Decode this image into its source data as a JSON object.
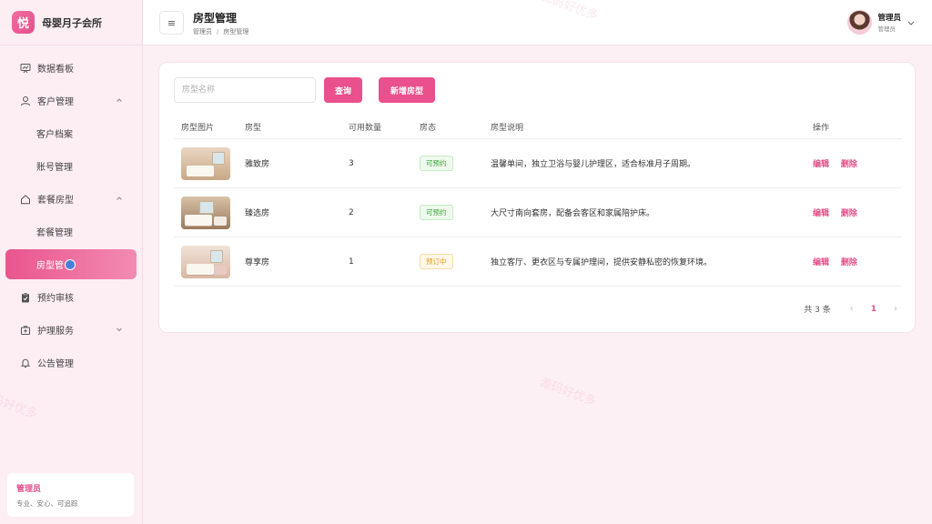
{
  "brand": {
    "logo_char": "悦",
    "name": "母婴月子会所"
  },
  "sidebar": {
    "items": [
      {
        "label": "数据看板",
        "icon": "chart-board-icon"
      },
      {
        "label": "客户管理",
        "icon": "user-icon",
        "expanded": true
      },
      {
        "label": "客户档案",
        "sub": true
      },
      {
        "label": "账号管理",
        "sub": true
      },
      {
        "label": "套餐房型",
        "icon": "home-icon",
        "expanded": true
      },
      {
        "label": "套餐管理",
        "sub": true
      },
      {
        "label": "房型管",
        "sub": true,
        "active": true
      },
      {
        "label": "预约审核",
        "icon": "clipboard-check-icon"
      },
      {
        "label": "护理服务",
        "icon": "first-aid-icon",
        "expanded": false
      },
      {
        "label": "公告管理",
        "icon": "bell-icon"
      }
    ],
    "card": {
      "title": "管理员",
      "subtitle": "专业、安心、可追踪"
    }
  },
  "header": {
    "menu_icon": "≡",
    "title": "房型管理",
    "breadcrumb": [
      "管理员",
      "房型管理"
    ],
    "breadcrumb_sep": "/",
    "user": {
      "name": "管理员",
      "role": "管理员"
    }
  },
  "search": {
    "placeholder": "房型名称",
    "value": "",
    "query_label": "查询",
    "add_label": "新增房型"
  },
  "table": {
    "columns": [
      "房型图片",
      "房型",
      "可用数量",
      "房态",
      "房型说明",
      "操作"
    ],
    "rows": [
      {
        "name": "雅致房",
        "qty": "3",
        "status": "可预约",
        "status_type": "ok",
        "desc": "温馨单间，独立卫浴与婴儿护理区，适合标准月子周期。"
      },
      {
        "name": "臻选房",
        "qty": "2",
        "status": "可预约",
        "status_type": "ok",
        "desc": "大尺寸南向套房，配备会客区和家属陪护床。"
      },
      {
        "name": "尊享房",
        "qty": "1",
        "status": "预订中",
        "status_type": "warn",
        "desc": "独立客厅、更衣区与专属护理间，提供安静私密的恢复环境。"
      }
    ],
    "edit_label": "编辑",
    "delete_label": "删除"
  },
  "pagination": {
    "total_text": "共 3 条",
    "current_page": "1",
    "prev": "‹",
    "next": "›"
  },
  "watermark": "源码好优多",
  "colors": {
    "accent": "#e9508c",
    "ok": "#3aa53a",
    "warn": "#e09a20",
    "background": "#fdf0f5"
  }
}
